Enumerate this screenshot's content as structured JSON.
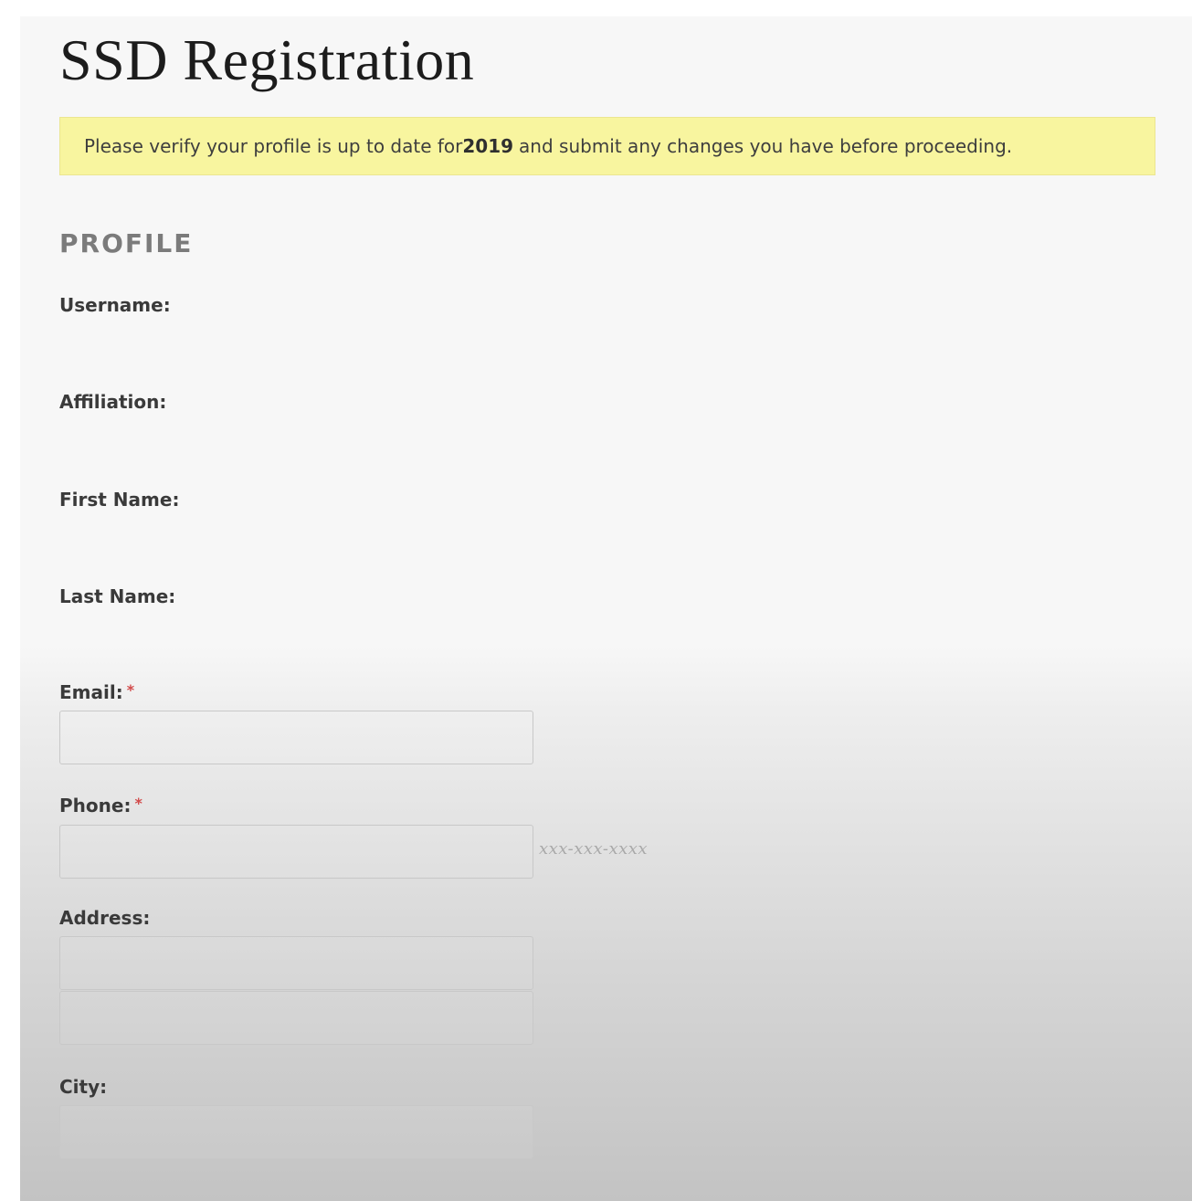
{
  "page": {
    "title": "SSD Registration"
  },
  "notice": {
    "text_before": "Please verify your profile is up to date for ",
    "year": "2019",
    "text_after": " and submit any changes you have before proceeding."
  },
  "profile": {
    "section_title": "PROFILE",
    "username": {
      "label": "Username:",
      "value": ""
    },
    "affiliation": {
      "label": "Affiliation:",
      "value": ""
    },
    "first_name": {
      "label": "First Name:",
      "value": ""
    },
    "last_name": {
      "label": "Last Name:",
      "value": ""
    },
    "email": {
      "label": "Email:",
      "required_marker": "*",
      "value": ""
    },
    "phone": {
      "label": "Phone:",
      "required_marker": "*",
      "value": "",
      "format_hint": "xxx-xxx-xxxx"
    },
    "address": {
      "label": "Address:",
      "line1_value": "",
      "line2_value": ""
    },
    "city": {
      "label": "City:",
      "value": ""
    }
  },
  "colors": {
    "notice_background": "#f8f59f",
    "required_marker": "#d24a4a",
    "section_title": "#7b7b7b"
  }
}
